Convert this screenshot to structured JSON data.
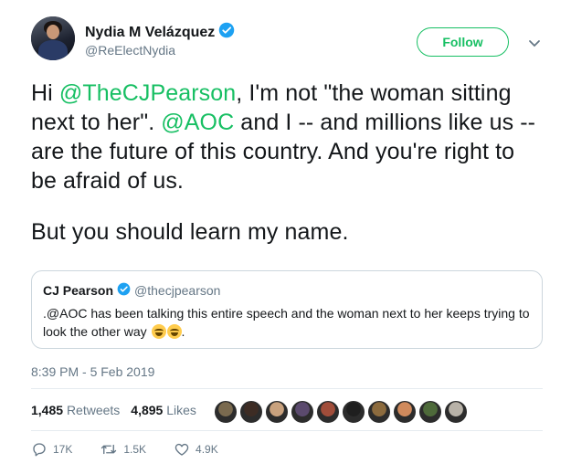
{
  "author": {
    "name": "Nydia M Velázquez",
    "handle": "@ReElectNydia",
    "verified": true
  },
  "follow_label": "Follow",
  "tweet": {
    "p1_parts": [
      "Hi ",
      "@TheCJPearson",
      ", I'm not \"the woman sitting next to her\". ",
      "@AOC",
      " and I -- and millions like us -- are the future of this country. And you're right to be afraid of us."
    ],
    "p2": "But you should learn my name."
  },
  "quoted": {
    "name": "CJ Pearson",
    "handle": "@thecjpearson",
    "text": ".@AOC has been talking this entire speech and the woman next to her keeps trying to look the other way",
    "emoji": "face-with-tears-of-joy x2"
  },
  "timestamp": "8:39 PM - 5 Feb 2019",
  "stats": {
    "retweets_count": "1,485",
    "retweets_label": "Retweets",
    "likes_count": "4,895",
    "likes_label": "Likes"
  },
  "likers": [
    "#7a6a4f",
    "#3d2c24",
    "#c9a27e",
    "#5b4a6e",
    "#a14d3a",
    "#1f1f1f",
    "#8c6b3e",
    "#d08a5c",
    "#4e6a3a",
    "#b8b2a8"
  ],
  "actions": {
    "replies": "17K",
    "retweets": "1.5K",
    "likes": "4.9K"
  },
  "colors": {
    "accent": "#17bf63",
    "verified": "#1da1f2",
    "muted": "#657786"
  }
}
